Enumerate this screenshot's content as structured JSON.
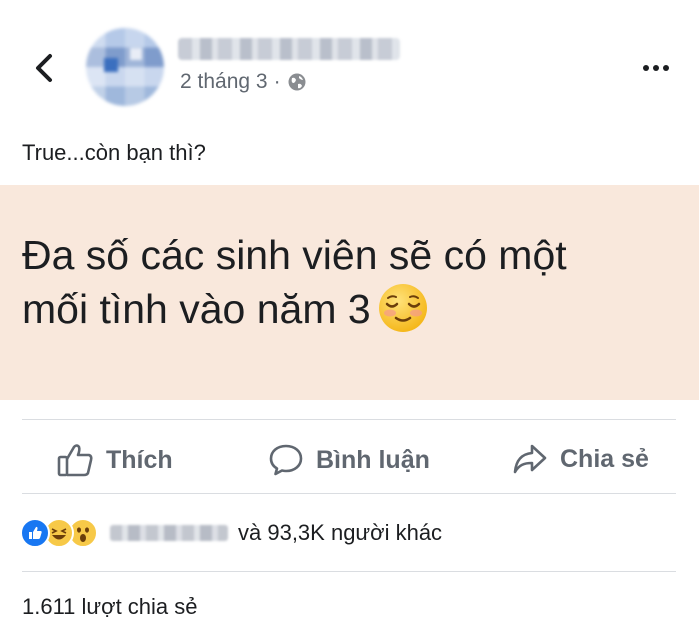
{
  "post": {
    "date": "2 tháng 3",
    "separator": "·",
    "caption": "True...còn bạn thì?",
    "status_line1": "Đa số các sinh viên sẽ có một",
    "status_line2": "mối tình vào năm 3",
    "status_background": "#f9e8dc"
  },
  "icons": {
    "back": "chevron-left-icon",
    "privacy": "globe-icon",
    "more": "more-options-icon",
    "emoji": "relieved-face-emoji"
  },
  "actions": {
    "like_label": "Thích",
    "comment_label": "Bình luận",
    "share_label": "Chia sẻ"
  },
  "reactions": {
    "types": [
      "like",
      "haha",
      "wow"
    ],
    "summary": "và 93,3K người khác"
  },
  "shares": {
    "count_text": "1.611 lượt chia sẻ"
  },
  "colors": {
    "like_blue": "#1877f2",
    "reaction_yellow": "#f7c948",
    "muted_text": "#606770"
  }
}
